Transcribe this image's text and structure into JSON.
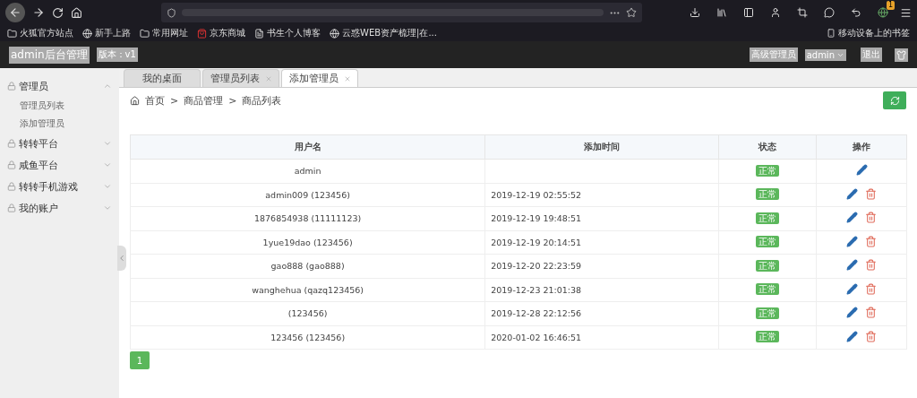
{
  "browser": {
    "menu_badge": "1",
    "bookmarks": [
      {
        "label": "火狐官方站点",
        "kind": "folder"
      },
      {
        "label": "新手上路",
        "kind": "globe"
      },
      {
        "label": "常用网址",
        "kind": "folder"
      },
      {
        "label": "京东商城",
        "kind": "shop"
      },
      {
        "label": "书生个人博客",
        "kind": "doc"
      },
      {
        "label": "云惑WEB资产梳理|在...",
        "kind": "globe"
      }
    ],
    "mobile_bookmarks": "移动设备上的书签"
  },
  "header": {
    "title": "admin后台管理",
    "version": "版本：v1",
    "role": "高级管理员",
    "user": "admin",
    "logout": "退出"
  },
  "sidebar": {
    "items": [
      {
        "label": "管理员",
        "expanded": true,
        "children": [
          {
            "label": "管理员列表"
          },
          {
            "label": "添加管理员"
          }
        ]
      },
      {
        "label": "转转平台",
        "expanded": false
      },
      {
        "label": "咸鱼平台",
        "expanded": false
      },
      {
        "label": "转转手机游戏",
        "expanded": false
      },
      {
        "label": "我的账户",
        "expanded": false
      }
    ]
  },
  "tabs": [
    {
      "label": "我的桌面",
      "selected": false,
      "closable": false
    },
    {
      "label": "管理员列表",
      "selected": false,
      "closable": true
    },
    {
      "label": "添加管理员",
      "selected": true,
      "closable": true
    }
  ],
  "breadcrumb": {
    "separator": ">",
    "items": [
      "首页",
      "商品管理",
      "商品列表"
    ]
  },
  "table": {
    "columns": [
      "用户名",
      "添加时间",
      "状态",
      "操作"
    ],
    "rows": [
      {
        "username": "admin",
        "time": "",
        "status": "正常",
        "deletable": false
      },
      {
        "username": "admin009 (123456)",
        "time": "2019-12-19 02:55:52",
        "status": "正常",
        "deletable": true
      },
      {
        "username": "1876854938 (11111123)",
        "time": "2019-12-19 19:48:51",
        "status": "正常",
        "deletable": true
      },
      {
        "username": "1yue19dao (123456)",
        "time": "2019-12-19 20:14:51",
        "status": "正常",
        "deletable": true
      },
      {
        "username": "gao888 (gao888)",
        "time": "2019-12-20 22:23:59",
        "status": "正常",
        "deletable": true
      },
      {
        "username": "wanghehua (qazq123456)",
        "time": "2019-12-23 21:01:38",
        "status": "正常",
        "deletable": true
      },
      {
        "username": "(123456)",
        "time": "2019-12-28 22:12:56",
        "status": "正常",
        "deletable": true
      },
      {
        "username": "123456 (123456)",
        "time": "2020-01-02 16:46:51",
        "status": "正常",
        "deletable": true
      }
    ]
  },
  "pagination": [
    {
      "label": "1",
      "selected": true
    }
  ]
}
